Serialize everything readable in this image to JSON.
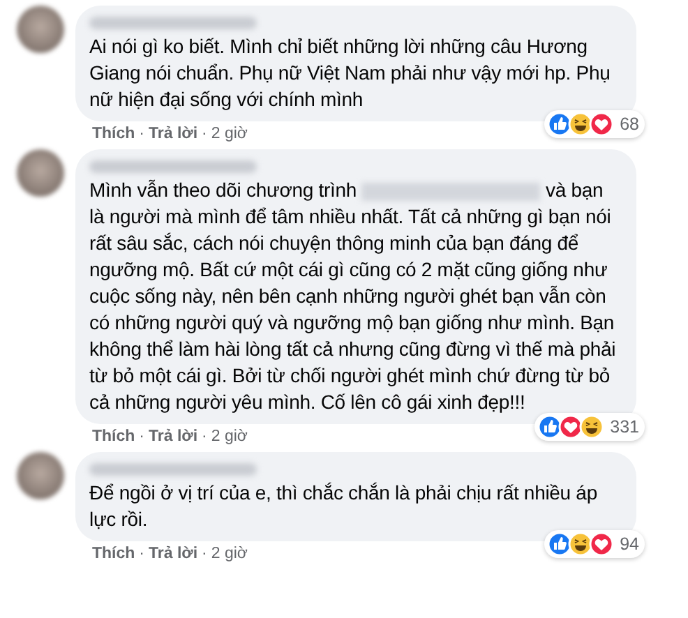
{
  "comments": [
    {
      "segments": [
        {
          "kind": "text",
          "text": "Ai nói gì ko biết. Mình chỉ biết những lời những câu Hương Giang nói chuẩn. Phụ nữ Việt Nam phải như vậy mới hp. Phụ nữ hiện đại sống với chính mình"
        }
      ],
      "reactions": [
        {
          "kind": "like"
        },
        {
          "kind": "haha"
        },
        {
          "kind": "love"
        }
      ],
      "reaction_count": "68",
      "actions": [
        {
          "kind": "like",
          "text": "Thích"
        },
        {
          "kind": "separator",
          "text": "·"
        },
        {
          "kind": "reply",
          "text": "Trả lời"
        },
        {
          "kind": "separator",
          "text": "·"
        },
        {
          "kind": "time",
          "text": "2 giờ"
        }
      ]
    },
    {
      "segments": [
        {
          "kind": "text",
          "text": "Mình vẫn theo dõi chương trình "
        },
        {
          "kind": "redacted"
        },
        {
          "kind": "text",
          "text": " và bạn là người mà mình để tâm nhiều nhất. Tất cả những gì bạn nói rất sâu sắc, cách nói chuyện thông minh của bạn đáng để ngưỡng mộ. Bất cứ một cái gì cũng có 2 mặt cũng giống như cuộc sống này, nên bên cạnh những người ghét bạn vẫn còn có những người quý và ngưỡng mộ bạn giống như mình. Bạn không thể làm hài lòng tất cả nhưng cũng đừng vì thế mà phải từ bỏ một cái gì. Bởi từ chối người ghét mình chứ đừng từ bỏ cả những người yêu mình. Cố lên cô gái xinh đẹp!!!"
        }
      ],
      "reactions": [
        {
          "kind": "like"
        },
        {
          "kind": "love"
        },
        {
          "kind": "haha"
        }
      ],
      "reaction_count": "331",
      "actions": [
        {
          "kind": "like",
          "text": "Thích"
        },
        {
          "kind": "separator",
          "text": "·"
        },
        {
          "kind": "reply",
          "text": "Trả lời"
        },
        {
          "kind": "separator",
          "text": "·"
        },
        {
          "kind": "time",
          "text": "2 giờ"
        }
      ]
    },
    {
      "segments": [
        {
          "kind": "text",
          "text": "Để ngồi ở vị trí của e, thì chắc chắn là phải chịu rất nhiều áp lực rồi."
        }
      ],
      "reactions": [
        {
          "kind": "like"
        },
        {
          "kind": "haha"
        },
        {
          "kind": "love"
        }
      ],
      "reaction_count": "94",
      "actions": [
        {
          "kind": "like",
          "text": "Thích"
        },
        {
          "kind": "separator",
          "text": "·"
        },
        {
          "kind": "reply",
          "text": "Trả lời"
        },
        {
          "kind": "separator",
          "text": "·"
        },
        {
          "kind": "time",
          "text": "2 giờ"
        }
      ]
    }
  ]
}
